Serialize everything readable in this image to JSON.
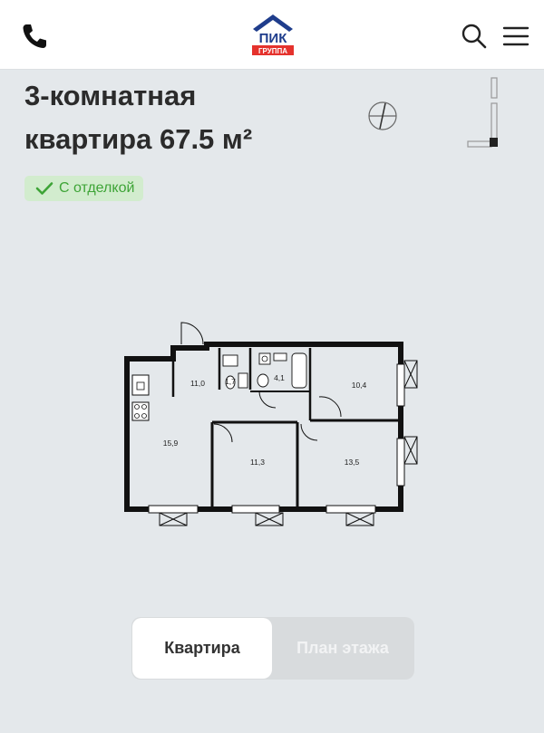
{
  "header": {
    "logo_top": "ПИК",
    "logo_bottom": "ГРУППА",
    "brand_color": "#1f3d8c",
    "logo_red": "#e5322d"
  },
  "apartment": {
    "title_line1": "3-комнатная",
    "title_line2": "квартира 67.5 м²",
    "finish_badge": "С отделкой",
    "badge_color": "#3ea437"
  },
  "floor_plan": {
    "rooms": [
      "11,0",
      "1,7",
      "4,1",
      "10,4",
      "15,9",
      "11,3",
      "13,5"
    ]
  },
  "view_toggle": {
    "options": [
      "Квартира",
      "План этажа"
    ],
    "selected": "Квартира"
  },
  "icons": [
    "phone-icon",
    "logo-icon",
    "search-icon",
    "menu-icon",
    "compass-icon",
    "checkmark-icon"
  ]
}
